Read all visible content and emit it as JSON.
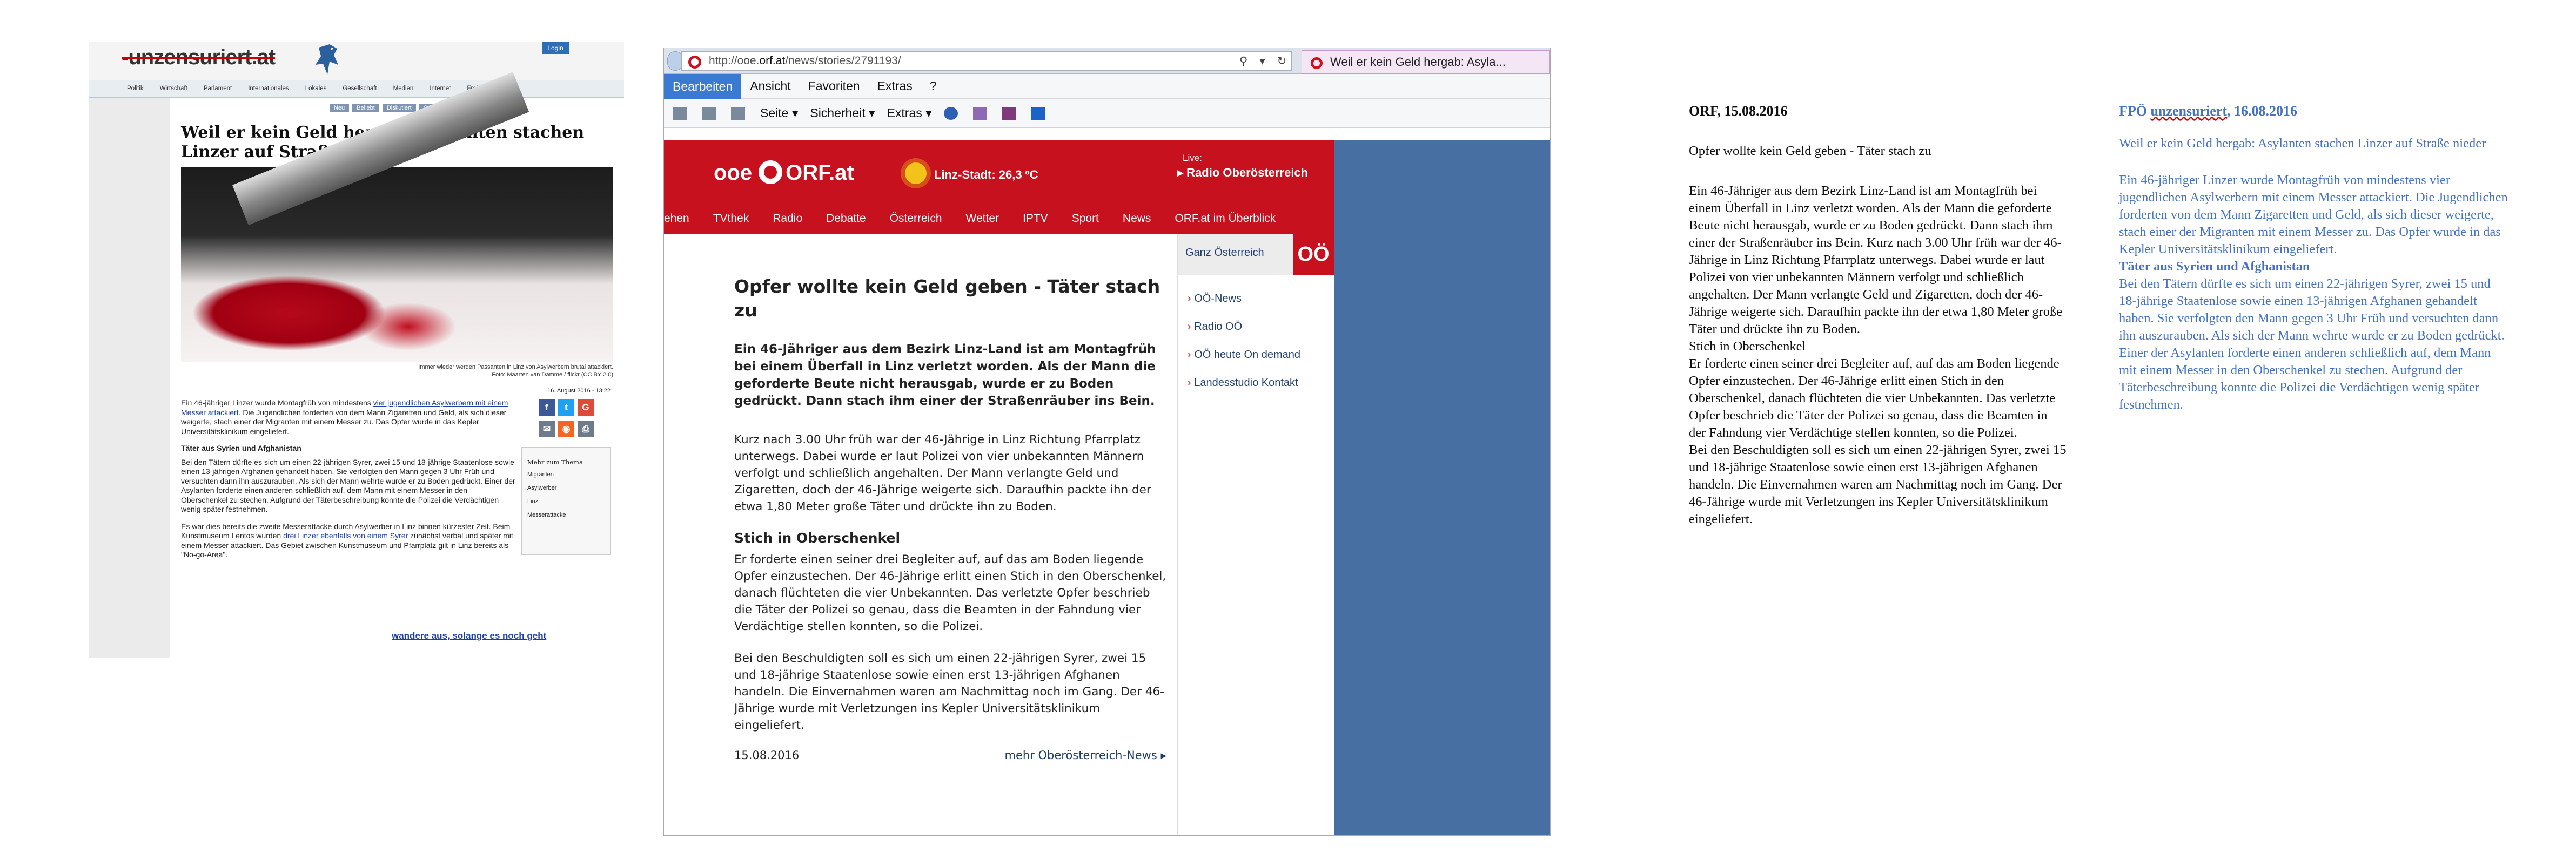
{
  "unzensuriert": {
    "logo": "-unzensuriert.at",
    "login": "Login",
    "nav": [
      "Politik",
      "Wirtschaft",
      "Parlament",
      "Internationales",
      "Lokales",
      "Gesellschaft",
      "Medien",
      "Internet",
      "Freizeit",
      "Re"
    ],
    "chips": [
      "Neu",
      "Beliebt",
      "Diskutiert",
      "Suche"
    ],
    "headline": "Weil er kein Geld hergab: Asylanten stachen Linzer auf Straße nieder",
    "caption1": "Immer wieder werden Passanten in Linz von Asylwerbern brutal attackiert.",
    "caption2": "Foto: Maarten van Damme / flickr (CC BY 2.0)",
    "date": "16. August 2016 - 13:22",
    "p1_a": "Ein 46-jähriger Linzer wurde Montagfrüh von mindestens ",
    "p1_link": "vier jugendlichen Asylwerbern mit einem Messer attackiert.",
    "p1_b": " Die Jugendlichen forderten von dem Mann Zigaretten und Geld, als sich dieser weigerte, stach einer der Migranten mit einem Messer zu. Das Opfer wurde in das Kepler Universitätsklinikum eingeliefert.",
    "subhead": "Täter aus Syrien und Afghanistan",
    "p2": "Bei den Tätern dürfte es sich um einen 22-jährigen Syrer, zwei 15 und 18-jährige Staatenlose sowie einen 13-jährigen Afghanen gehandelt haben. Sie verfolgten den Mann gegen 3 Uhr Früh und versuchten dann ihn auszurauben. Als sich der Mann wehrte wurde er zu Boden gedrückt. Einer der Asylanten forderte einen anderen schließlich auf, dem Mann mit einem Messer in den Oberschenkel zu stechen. Aufgrund der Täterbeschreibung konnte die Polizei die Verdächtigen wenig später festnehmen.",
    "p3_a": "Es war dies bereits die zweite Messerattacke durch Asylwerber in Linz binnen kürzester Zeit. Beim Kunstmuseum Lentos wurden ",
    "p3_link": "drei Linzer ebenfalls von einem Syrer",
    "p3_b": " zunächst verbal und später mit einem Messer attackiert. Das Gebiet zwischen Kunstmuseum und Pfarrplatz gilt in Linz bereits als \"No-go-Area\".",
    "cta": "wandere aus, solange es noch geht",
    "more_title": "Mehr zum Thema",
    "more_items": [
      "Migranten",
      "Asylwerber",
      "Linz",
      "Messerattacke"
    ],
    "social_colors": {
      "facebook": "#3b5998",
      "twitter": "#1da1f2",
      "google": "#dd4b39",
      "mail": "#6d7b8a",
      "rss": "#f26522",
      "print": "#6d7b8a"
    }
  },
  "browser": {
    "url_prefix": "http://ooe.",
    "url_domain": "orf.at",
    "url_path": "/news/stories/2791193/",
    "url_icons": "⚲ ▾ ↻",
    "tab_title": "Weil er kein Geld hergab: Asyla...",
    "menu": [
      "Bearbeiten",
      "Ansicht",
      "Favoriten",
      "Extras",
      "?"
    ],
    "toolbar": [
      "Seite ▾",
      "Sicherheit ▾",
      "Extras ▾"
    ],
    "orf_logo_pre": "ooe",
    "orf_logo_post": "ORF.at",
    "weather": "Linz-Stadt: 26,3 ºC",
    "live": "Live:",
    "radio": "▸ Radio Oberösterreich",
    "sitenav": [
      "ehen",
      "TVthek",
      "Radio",
      "Debatte",
      "Österreich",
      "Wetter",
      "IPTV",
      "Sport",
      "News",
      "ORF.at im Überblick"
    ],
    "rail_top": "Ganz Österreich",
    "rail_badge": "OÖ",
    "rail_items": [
      "OÖ-News",
      "Radio OÖ",
      "OÖ heute On demand",
      "Landesstudio Kontakt"
    ],
    "headline": "Opfer wollte kein Geld geben - Täter stach zu",
    "lead": "Ein 46-Jähriger aus dem Bezirk Linz-Land ist am Montagfrüh bei einem Überfall in Linz verletzt worden. Als der Mann die geforderte Beute nicht herausgab, wurde er zu Boden gedrückt. Dann stach ihm einer der Straßenräuber ins Bein.",
    "p1": "Kurz nach 3.00 Uhr früh war der 46-Jährige in Linz Richtung Pfarrplatz unterwegs. Dabei wurde er laut Polizei von vier unbekannten Männern verfolgt und schließlich angehalten. Der Mann verlangte Geld und Zigaretten, doch der 46-Jährige weigerte sich. Daraufhin packte ihn der etwa 1,80 Meter große Täter und drückte ihn zu Boden.",
    "h2": "Stich in Oberschenkel",
    "p2": "Er forderte einen seiner drei Begleiter auf, auf das am Boden liegende Opfer einzustechen. Der 46-Jährige erlitt einen Stich in den Oberschenkel, danach flüchteten die vier Unbekannten. Das verletzte Opfer beschrieb die Täter der Polizei so genau, dass die Beamten in der Fahndung vier Verdächtige stellen konnten, so die Polizei.",
    "p3": "Bei den Beschuldigten soll es sich um einen 22-jährigen Syrer, zwei 15 und 18-jährige Staatenlose sowie einen erst 13-jährigen Afghanen handeln. Die Einvernahmen waren am Nachmittag noch im Gang. Der 46-Jährige wurde mit Verletzungen ins Kepler Universitätsklinikum eingeliefert.",
    "date": "15.08.2016",
    "more": "mehr Oberösterreich-News ▸"
  },
  "orf_text": {
    "date": "ORF, 15.08.2016",
    "title": "Opfer wollte kein Geld geben - Täter stach zu",
    "body1": "Ein 46-Jähriger aus dem Bezirk Linz-Land ist am Montagfrüh bei einem Überfall in Linz verletzt worden. Als der Mann die geforderte Beute nicht herausgab, wurde er zu Boden gedrückt. Dann stach ihm einer der Straßenräuber ins Bein. Kurz nach 3.00 Uhr früh war der 46-Jährige in Linz Richtung Pfarrplatz unterwegs. Dabei wurde er laut Polizei von vier unbekannten Männern verfolgt und schließlich angehalten. Der Mann verlangte Geld und Zigaretten, doch der 46-Jährige weigerte sich. Daraufhin packte ihn der etwa 1,80 Meter große Täter und drückte ihn zu Boden.",
    "sub": "Stich in Oberschenkel",
    "body2": "Er forderte einen seiner drei Begleiter auf, auf das am Boden liegende Opfer einzustechen. Der 46-Jährige erlitt einen Stich in den Oberschenkel, danach flüchteten die vier Unbekannten. Das verletzte Opfer beschrieb die Täter der Polizei so genau, dass die Beamten in der Fahndung vier Verdächtige stellen konnten, so die Polizei.",
    "body3": "Bei den Beschuldigten soll es sich um einen 22-jährigen Syrer, zwei 15 und 18-jährige Staatenlose sowie einen erst 13-jährigen Afghanen handeln. Die Einvernahmen waren am Nachmittag noch im Gang. Der 46-Jährige wurde mit Verletzungen ins Kepler Universitätsklinikum eingeliefert."
  },
  "fpoe_text": {
    "date_pre": "FPÖ ",
    "date_name": "unzensuriert",
    "date_post": ", 16.08.2016",
    "title": "Weil er kein Geld hergab: Asylanten stachen Linzer auf Straße nieder",
    "body1": "Ein 46-jähriger Linzer wurde Montagfrüh von mindestens vier jugendlichen Asylwerbern mit einem Messer attackiert. Die Jugendlichen forderten von dem Mann Zigaretten und Geld, als sich dieser weigerte, stach einer der Migranten mit einem Messer zu. Das Opfer wurde in das Kepler Universitätsklinikum eingeliefert.",
    "sub": "Täter aus Syrien und Afghanistan",
    "body2": "Bei den Tätern dürfte es sich um einen 22-jährigen Syrer, zwei 15 und 18-jährige Staatenlose sowie einen 13-jährigen Afghanen gehandelt haben. Sie verfolgten den Mann gegen 3 Uhr Früh und versuchten dann ihn auszurauben. Als sich der Mann wehrte wurde er zu Boden gedrückt. Einer der Asylanten forderte einen anderen schließlich auf, dem Mann mit einem Messer in den Oberschenkel zu stechen. Aufgrund der Täterbeschreibung konnte die Polizei die Verdächtigen wenig später festnehmen."
  }
}
